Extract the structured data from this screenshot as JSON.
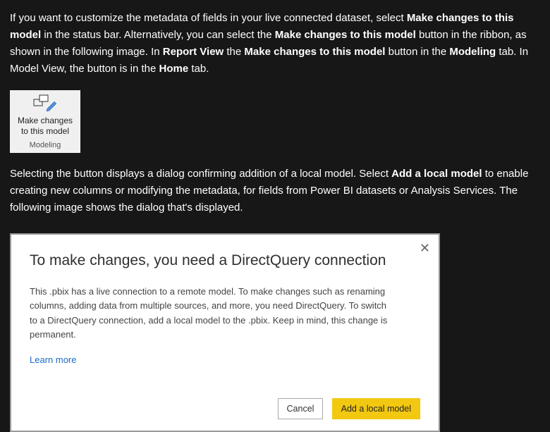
{
  "para1": {
    "t1": "If you want to customize the metadata of fields in your live connected dataset, select ",
    "b1": "Make changes to this model",
    "t2": " in the status bar. Alternatively, you can select the ",
    "b2": "Make changes to this model",
    "t3": " button in the ribbon, as shown in the following image. In ",
    "b3": "Report View",
    "t4": " the ",
    "b4": "Make changes to this model",
    "t5": " button in the ",
    "b5": "Modeling",
    "t6": " tab. In Model View, the button is in the ",
    "b6": "Home",
    "t7": " tab."
  },
  "ribbon": {
    "line1": "Make changes",
    "line2": "to this model",
    "tab": "Modeling"
  },
  "para2": {
    "t1": "Selecting the button displays a dialog confirming addition of a local model. Select ",
    "b1": "Add a local model",
    "t2": " to enable creating new columns or modifying the metadata, for fields from Power BI datasets or Analysis Services. The following image shows the dialog that's displayed."
  },
  "dialog": {
    "title": "To make changes, you need a DirectQuery connection",
    "body": "This .pbix has a live connection to a remote model. To make changes such as renaming columns, adding data from multiple sources, and more, you need DirectQuery. To switch to a DirectQuery connection, add a local model to the .pbix. Keep in mind, this change is permanent.",
    "learn_more": "Learn more",
    "cancel": "Cancel",
    "add": "Add a local model"
  }
}
